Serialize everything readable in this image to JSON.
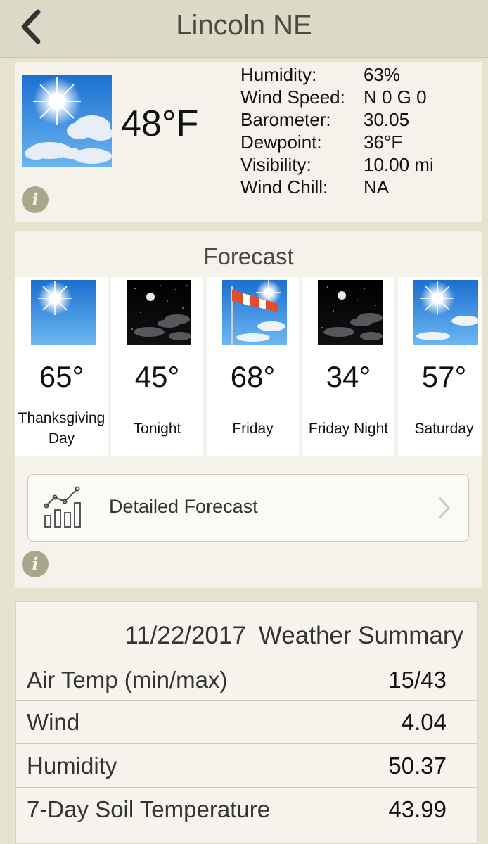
{
  "nav": {
    "title": "Lincoln NE"
  },
  "current": {
    "temperature": "48°F",
    "icon": "partly-cloudy-sun-icon",
    "rows": [
      {
        "label": "Humidity:",
        "value": "63%"
      },
      {
        "label": "Wind Speed:",
        "value": "N 0 G 0"
      },
      {
        "label": "Barometer:",
        "value": "30.05"
      },
      {
        "label": "Dewpoint:",
        "value": "36°F"
      },
      {
        "label": "Visibility:",
        "value": "10.00 mi"
      },
      {
        "label": "Wind Chill:",
        "value": "NA"
      }
    ],
    "info_glyph": "i"
  },
  "forecast": {
    "heading": "Forecast",
    "days": [
      {
        "temp": "65°",
        "name": "Thanksgiving Day",
        "icon": "sunny-icon"
      },
      {
        "temp": "45°",
        "name": "Tonight",
        "icon": "clear-night-icon"
      },
      {
        "temp": "68°",
        "name": "Friday",
        "icon": "windy-icon"
      },
      {
        "temp": "34°",
        "name": "Friday Night",
        "icon": "clear-night-icon"
      },
      {
        "temp": "57°",
        "name": "Saturday",
        "icon": "sunny-icon"
      }
    ],
    "detailed_label": "Detailed Forecast",
    "info_glyph": "i"
  },
  "summary": {
    "date": "11/22/2017",
    "title": "Weather Summary",
    "rows": [
      {
        "label": "Air Temp (min/max)",
        "value": "15/43"
      },
      {
        "label": "Wind",
        "value": "4.04"
      },
      {
        "label": "Humidity",
        "value": "50.37"
      },
      {
        "label": "7-Day Soil Temperature",
        "value": "43.99"
      }
    ]
  },
  "colors": {
    "background": "#e6e3cf",
    "card": "#f4f2ea",
    "info_icon": "#aaa68c",
    "sky_blue": "#2b8be0"
  }
}
